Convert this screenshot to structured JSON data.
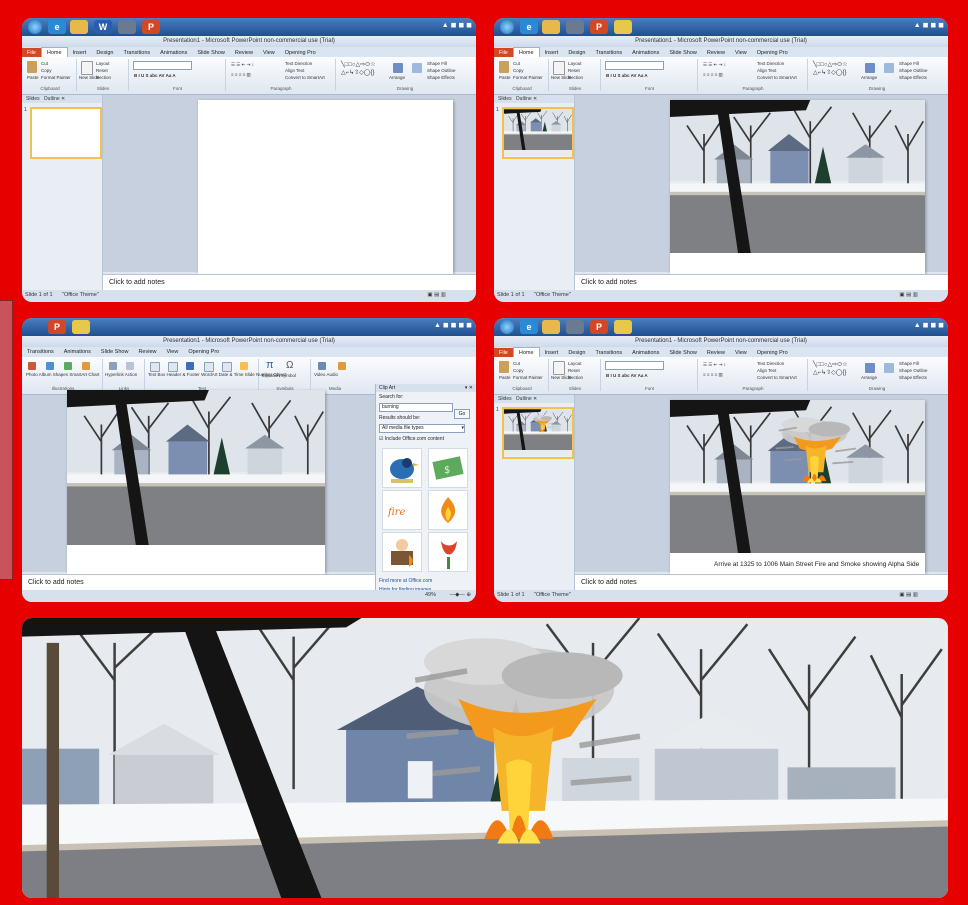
{
  "colors": {
    "frame": "#e60000",
    "ribbon": "#dfe7f1",
    "file_tab": "#d24726",
    "selection": "#f4c14f"
  },
  "window_title": "Presentation1 - Microsoft PowerPoint non-commercial use (Trial)",
  "ribbon_tabs": [
    "File",
    "Home",
    "Insert",
    "Design",
    "Transitions",
    "Animations",
    "Slide Show",
    "Review",
    "View",
    "Opening Pro"
  ],
  "insert_ribbon_tabs": [
    "Transitions",
    "Animations",
    "Slide Show",
    "Review",
    "View",
    "Opening Pro"
  ],
  "pane_tabs": [
    "Slides",
    "Outline"
  ],
  "notes_placeholder": "Click to add notes",
  "status_bar": {
    "slide": "Slide 1 of 1",
    "theme": "\"Office Theme\"",
    "zoom": "49%"
  },
  "home_ribbon": {
    "clipboard": {
      "paste": "Paste",
      "cut": "Cut",
      "copy": "Copy",
      "format_painter": "Format Painter",
      "group": "Clipboard"
    },
    "slides": {
      "new_slide": "New Slide",
      "layout": "Layout",
      "reset": "Reset",
      "section": "Section",
      "group": "Slides"
    },
    "groups": [
      "Font",
      "Paragraph",
      "Drawing"
    ],
    "paragraph_items": [
      "Text Direction",
      "Align Text",
      "Convert to SmartArt"
    ],
    "drawing_items": [
      "Arrange",
      "Quick Styles",
      "Shape Fill",
      "Shape Outline",
      "Shape Effects"
    ]
  },
  "insert_ribbon": {
    "items": [
      "Photo Album",
      "Shapes",
      "SmartArt",
      "Chart",
      "Hyperlink",
      "Action",
      "Text Box",
      "Header & Footer",
      "WordArt",
      "Date & Time",
      "Slide Number",
      "Object",
      "Equation",
      "Symbol",
      "Video",
      "Audio"
    ],
    "groups": [
      "Illustrations",
      "Links",
      "Text",
      "Symbols",
      "Media"
    ]
  },
  "clip_art": {
    "title": "Clip Art",
    "search_label": "Search for:",
    "search_value": "burning",
    "go_button": "Go",
    "results_label": "Results should be:",
    "results_value": "All media file types",
    "include_office": "Include Office.com content",
    "find_more": "Find more at Office.com",
    "hints": "Hints for finding images"
  },
  "slide_caption": "Arrive at 1325 to 1006 Main Street Fire and Smoke showing Alpha Side"
}
